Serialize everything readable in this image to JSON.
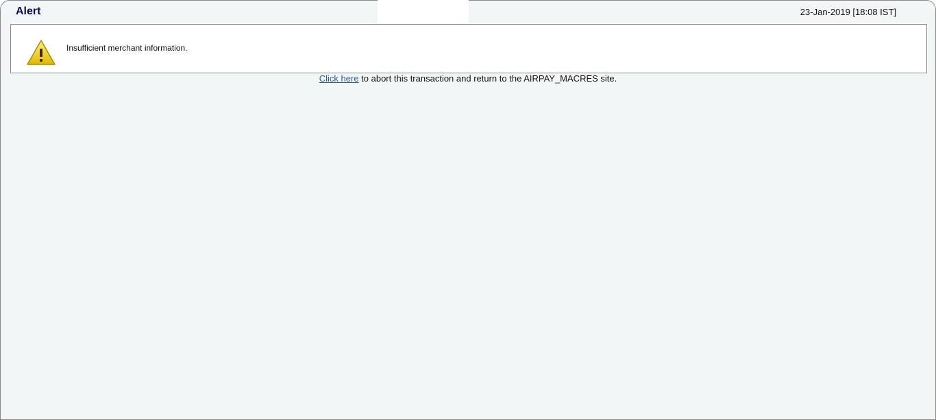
{
  "header": {
    "title": "Alert",
    "timestamp": "23-Jan-2019 [18:08 IST]"
  },
  "alert": {
    "icon": "warning-icon",
    "message": "Insufficient merchant information."
  },
  "abort": {
    "link_text": "Click here",
    "rest_text": " to abort this transaction and return to the AIRPAY_MACRES site."
  },
  "colors": {
    "title": "#0b0b5c",
    "link": "#2a5d8f",
    "background": "#f3f6f6",
    "warning_yellow": "#f5d20b"
  }
}
